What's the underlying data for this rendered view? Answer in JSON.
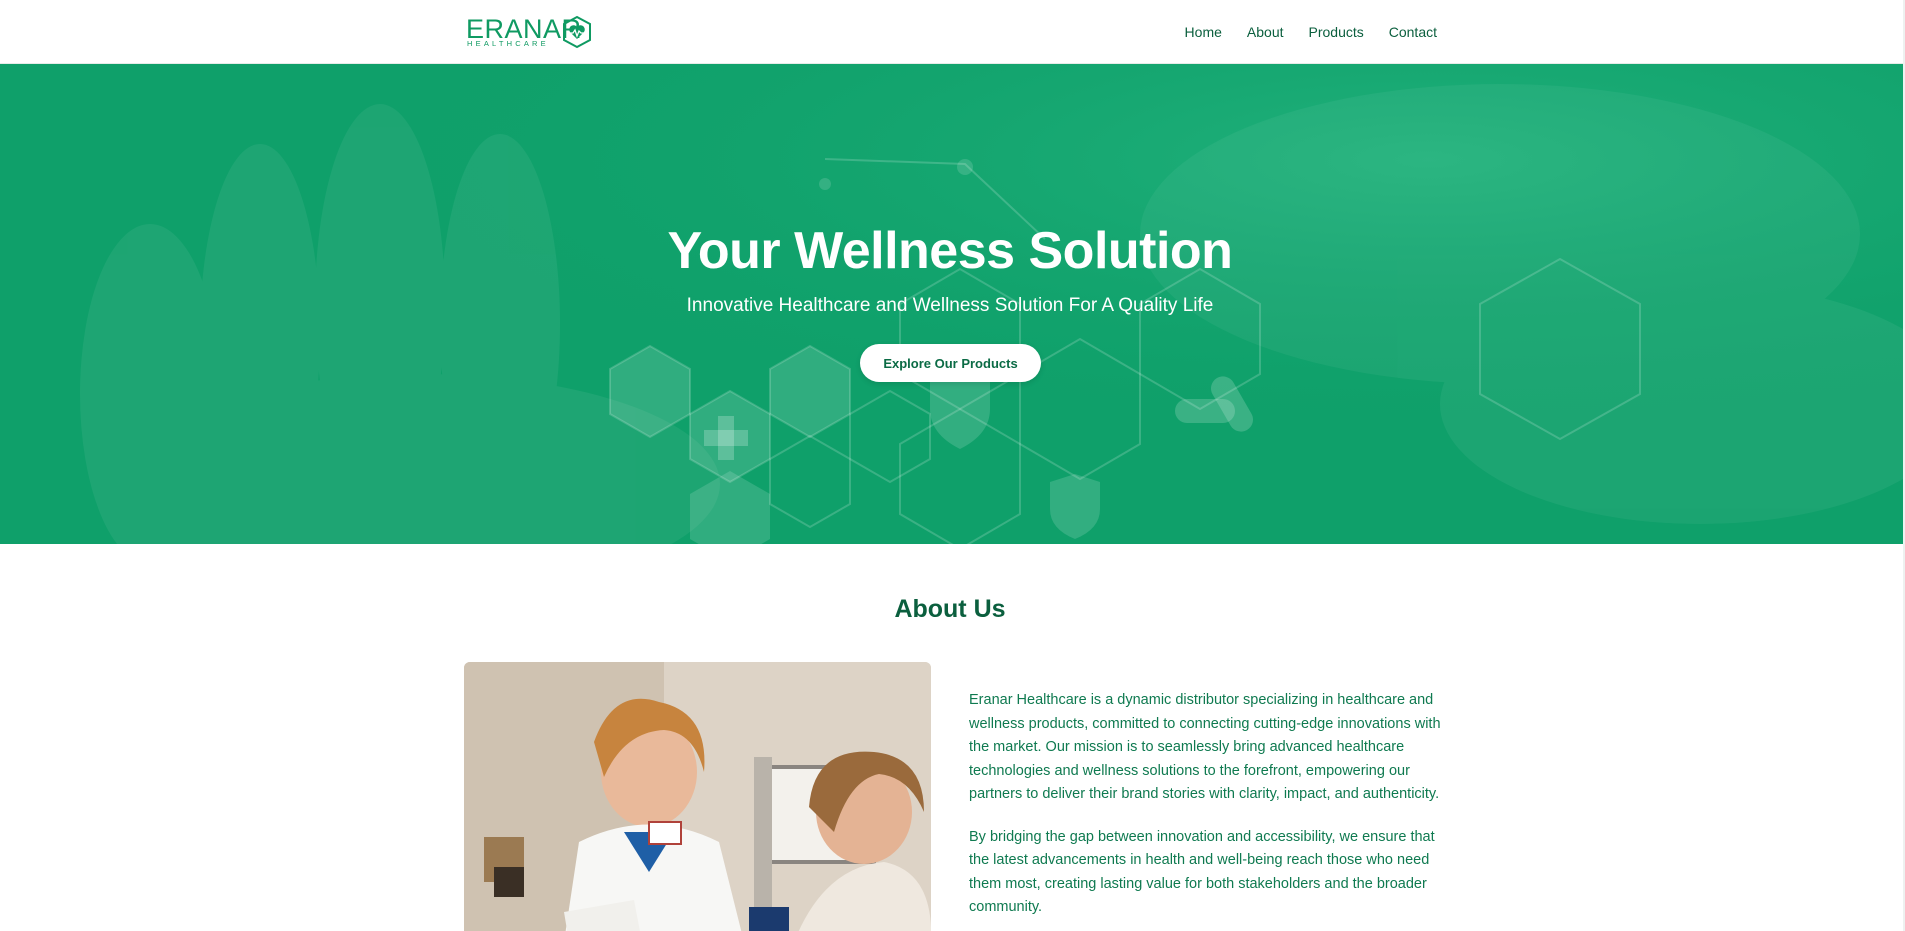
{
  "brand": {
    "name": "ERANAR",
    "subtitle": "HEALTHCARE",
    "color": "#0f9a62"
  },
  "nav": {
    "items": [
      {
        "label": "Home"
      },
      {
        "label": "About"
      },
      {
        "label": "Products"
      },
      {
        "label": "Contact"
      }
    ]
  },
  "hero": {
    "title": "Your Wellness Solution",
    "subtitle": "Innovative Healthcare and Wellness Solution For A Quality Life",
    "cta_label": "Explore Our Products",
    "background_color": "#0fa06a"
  },
  "about": {
    "title": "About Us",
    "paragraphs": [
      "Eranar Healthcare is a dynamic distributor specializing in healthcare and wellness products, committed to connecting cutting-edge innovations with the market. Our mission is to seamlessly bring advanced healthcare technologies and wellness solutions to the forefront, empowering our partners to deliver their brand stories with clarity, impact, and authenticity.",
      "By bridging the gap between innovation and accessibility, we ensure that the latest advancements in health and well-being reach those who need them most, creating lasting value for both stakeholders and the broader community."
    ]
  }
}
